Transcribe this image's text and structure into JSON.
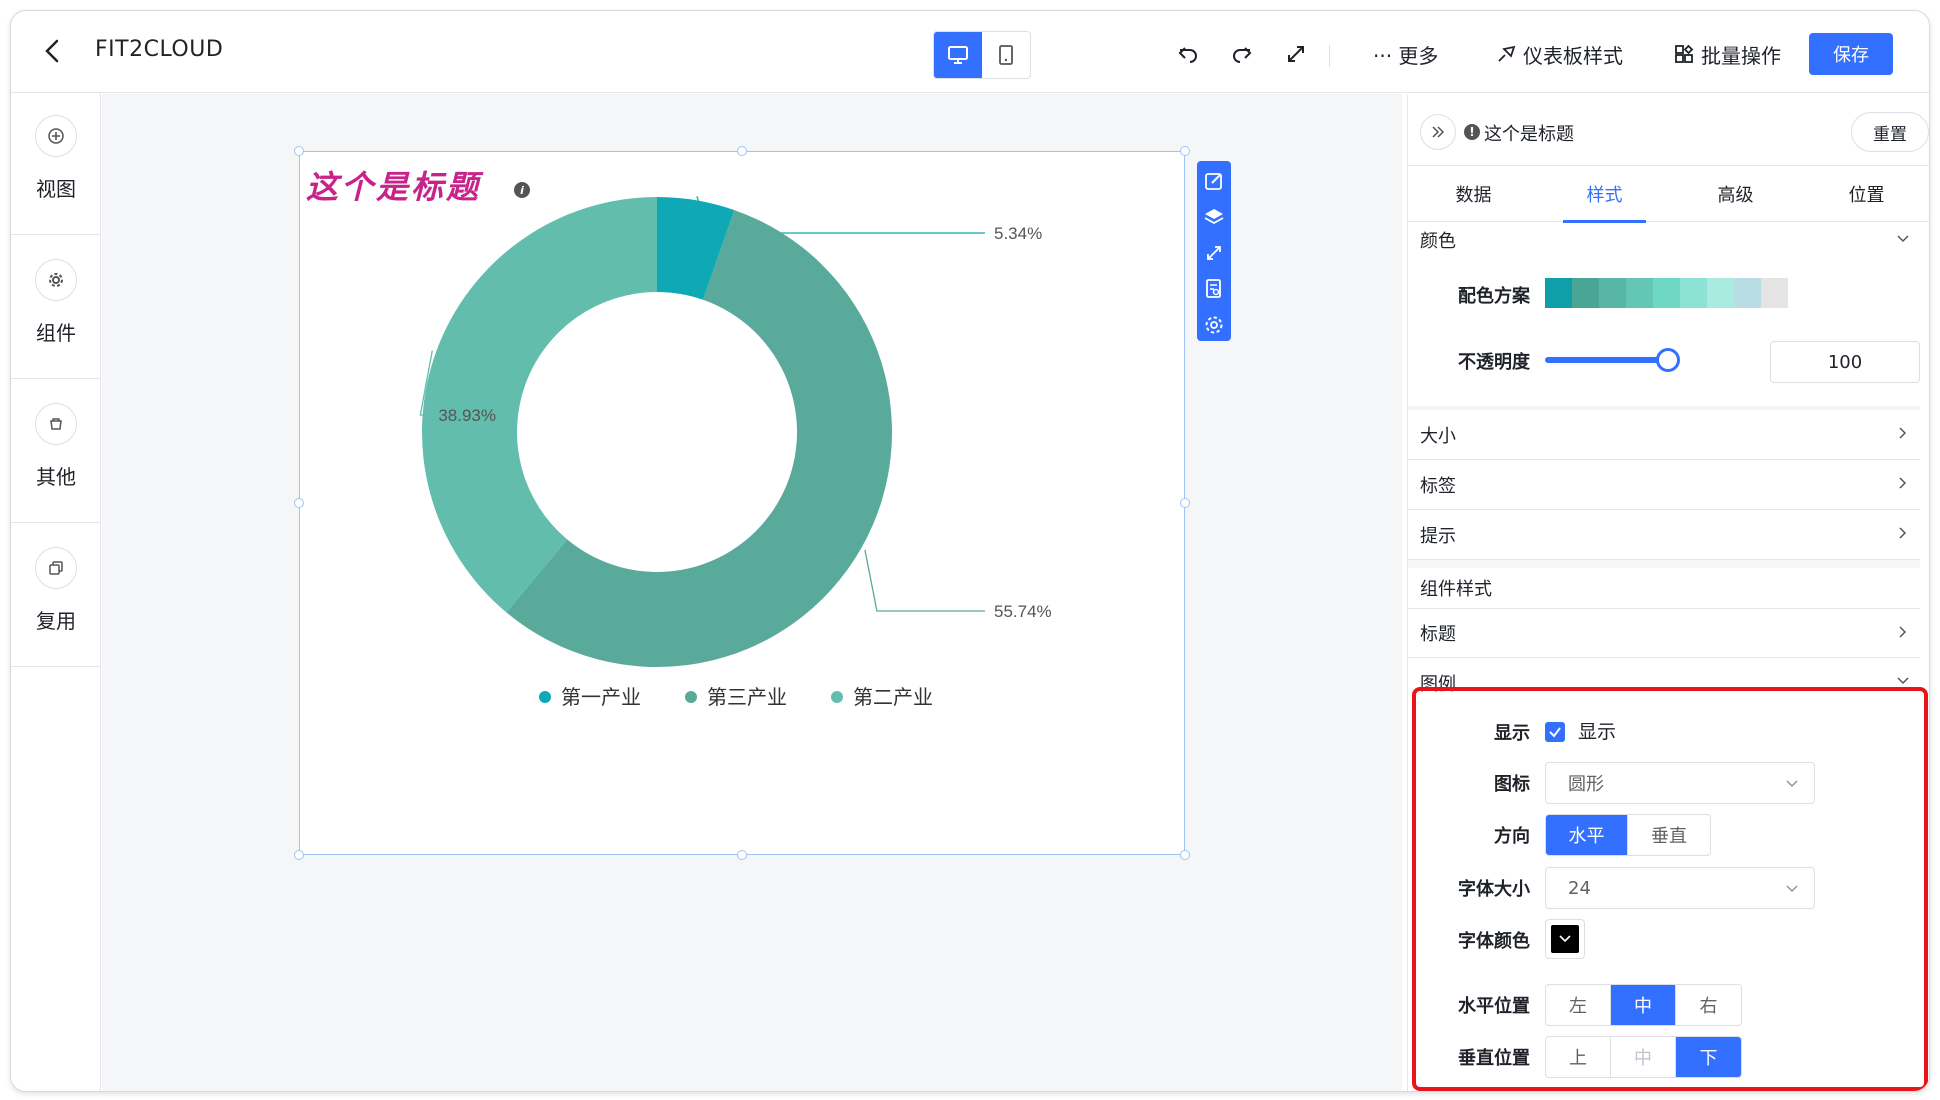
{
  "header": {
    "app_title": "FIT2CLOUD",
    "more_label": "··· 更多",
    "dashboard_style_label": "仪表板样式",
    "batch_label": "批量操作",
    "save_label": "保存"
  },
  "sidebar": {
    "items": [
      {
        "label": "视图",
        "icon": "plus-circle-icon"
      },
      {
        "label": "组件",
        "icon": "gear-icon"
      },
      {
        "label": "其他",
        "icon": "other-icon"
      },
      {
        "label": "复用",
        "icon": "copy-icon"
      }
    ]
  },
  "widget": {
    "title": "这个是标题",
    "title_color": "#c7238a"
  },
  "chart_data": {
    "type": "pie",
    "donut": true,
    "categories": [
      "第一产业",
      "第二产业",
      "第三产业"
    ],
    "values": [
      5.34,
      55.74,
      38.93
    ],
    "colors": [
      "#0fa8b5",
      "#59aa9b",
      "#62bdad"
    ],
    "data_labels": [
      "5.34%",
      "55.74%",
      "38.93%"
    ],
    "legend": {
      "items": [
        "第一产业",
        "第三产业",
        "第二产业"
      ],
      "colors": [
        "#0fa8b5",
        "#59aa9b",
        "#62bdad"
      ],
      "placement": "bottom-center"
    }
  },
  "panel": {
    "title": "这个是标题",
    "reset_label": "重置",
    "tabs": [
      "数据",
      "样式",
      "高级",
      "位置"
    ],
    "active_tab": "样式",
    "color_section": "颜色",
    "palette_label": "配色方案",
    "palette_colors": [
      "#0f9faa",
      "#4aa596",
      "#57b6a6",
      "#64c7b6",
      "#6fd8c5",
      "#8ce2d3",
      "#a9ebdf",
      "#b9dde5",
      "#e4e4e4"
    ],
    "opacity_label": "不透明度",
    "opacity_value": "100",
    "size_section": "大小",
    "label_section": "标签",
    "tooltip_section": "提示",
    "component_style_group": "组件样式",
    "title_section": "标题",
    "legend_section": "图例",
    "legend": {
      "show_label": "显示",
      "show_checkbox_label": "显示",
      "icon_label": "图标",
      "icon_value": "圆形",
      "orient_label": "方向",
      "orient_options": [
        "水平",
        "垂直"
      ],
      "orient_selected": "水平",
      "font_size_label": "字体大小",
      "font_size_value": "24",
      "font_color_label": "字体颜色",
      "font_color": "#000000",
      "h_pos_label": "水平位置",
      "h_pos_options": [
        "左",
        "中",
        "右"
      ],
      "h_pos_selected": "中",
      "v_pos_label": "垂直位置",
      "v_pos_options": [
        "上",
        "中",
        "下"
      ],
      "v_pos_selected": "下"
    }
  }
}
